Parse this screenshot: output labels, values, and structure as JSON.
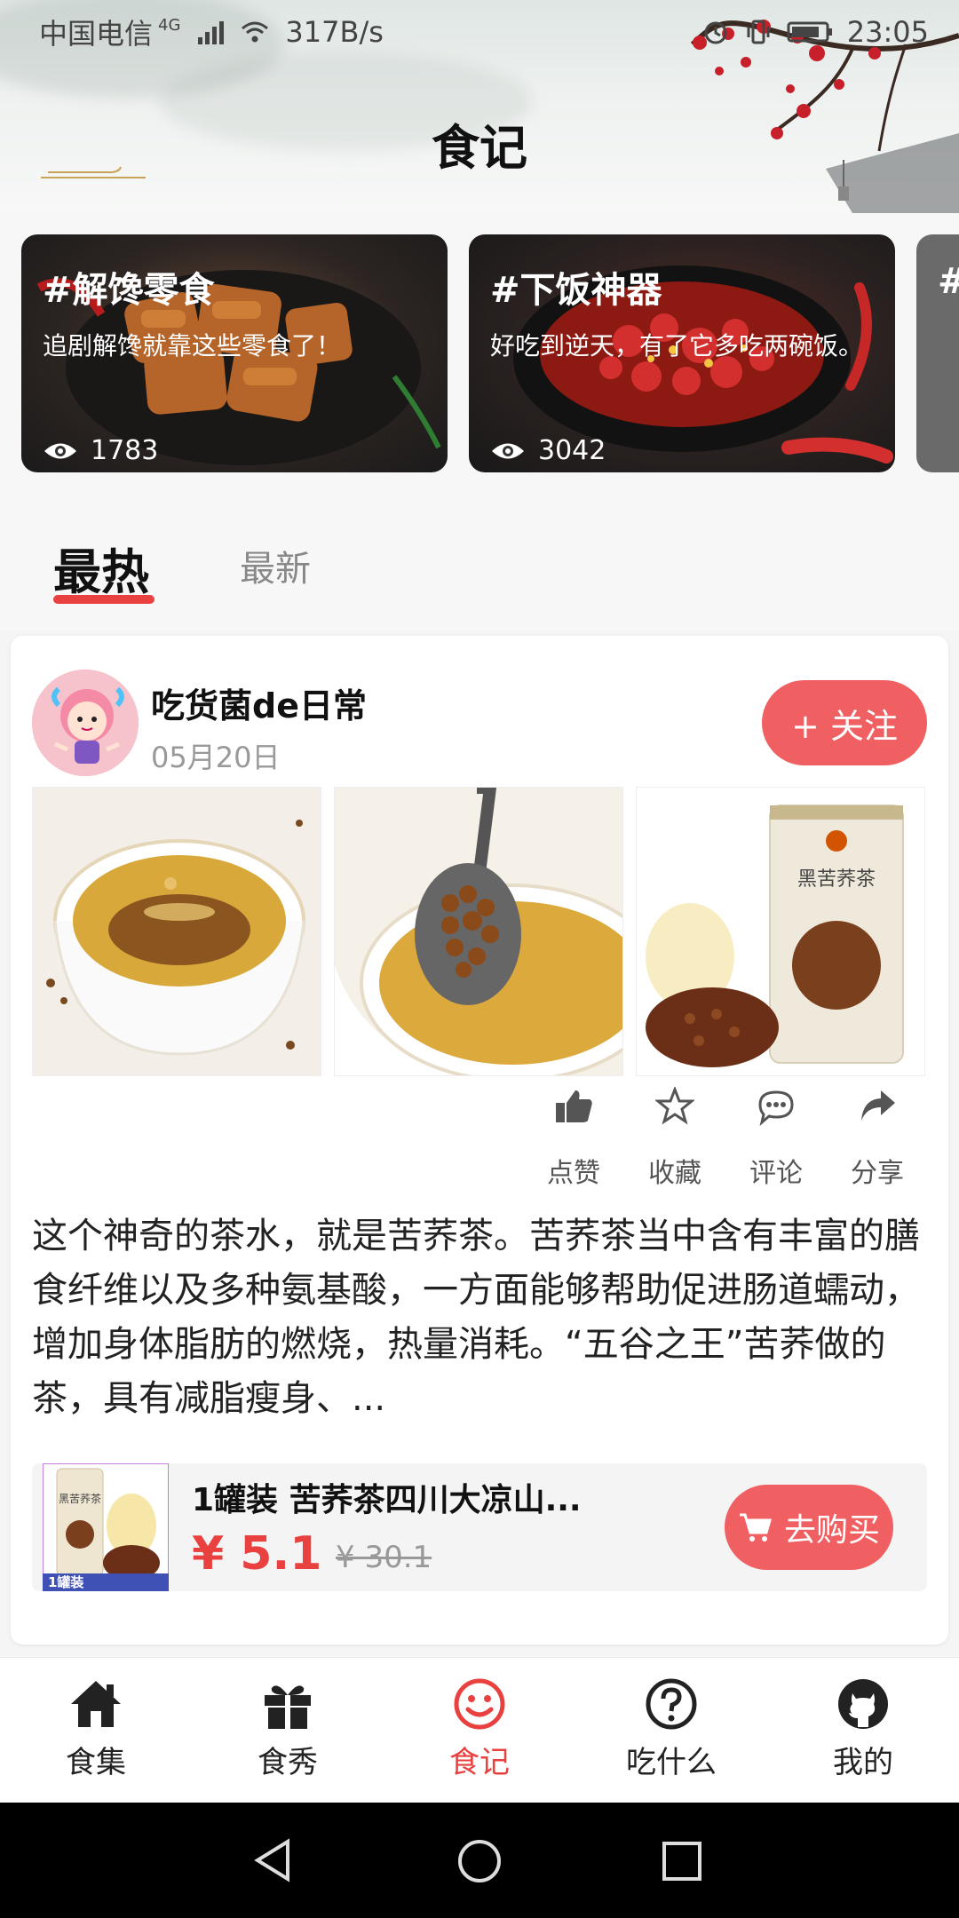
{
  "status_bar": {
    "carrier": "中国电信",
    "network": "4G",
    "speed": "317B/s",
    "time": "23:05"
  },
  "header": {
    "title": "食记"
  },
  "topics": [
    {
      "title": "#解馋零食",
      "subtitle": "追剧解馋就靠这些零食了！",
      "views": "1783"
    },
    {
      "title": "#下饭神器",
      "subtitle": "好吃到逆天，有了它多吃两碗饭。",
      "views": "3042"
    },
    {
      "title": "#",
      "subtitle": "",
      "views": ""
    }
  ],
  "tabs": {
    "hot": "最热",
    "new": "最新"
  },
  "post": {
    "author": "吃货菌de日常",
    "date": "05月20日",
    "follow_label": "+ 关注",
    "actions": {
      "like": "点赞",
      "collect": "收藏",
      "comment": "评论",
      "share": "分享"
    },
    "text": "这个神奇的茶水，就是苦荞茶。苦荞茶当中含有丰富的膳食纤维以及多种氨基酸，一方面能够帮助促进肠道蠕动，增加身体脂肪的燃烧，热量消耗。“五谷之王”苦荞做的茶，具有减脂瘦身、...",
    "product": {
      "title": "1罐装 苦荞茶四川大凉山...",
      "price": "¥ 5.1",
      "old_price": "¥ 30.1",
      "buy_label": "去购买",
      "thumb_badge": "1罐装",
      "thumb_label": "黑苦荞茶",
      "can_label": "黑苦荞茶"
    }
  },
  "bottom_nav": [
    {
      "label": "食集",
      "icon": "home-icon"
    },
    {
      "label": "食秀",
      "icon": "gift-icon"
    },
    {
      "label": "食记",
      "icon": "smile-icon"
    },
    {
      "label": "吃什么",
      "icon": "question-icon"
    },
    {
      "label": "我的",
      "icon": "github-icon"
    }
  ],
  "colors": {
    "accent": "#e8413f",
    "button": "#f06062"
  }
}
